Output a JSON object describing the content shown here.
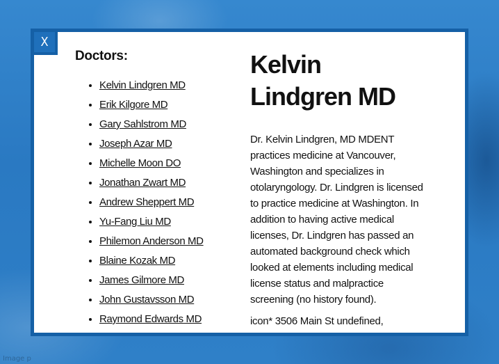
{
  "modal": {
    "close_label": "X"
  },
  "doctors": {
    "heading": "Doctors:",
    "items": [
      {
        "label": "Kelvin Lindgren MD"
      },
      {
        "label": "Erik Kilgore MD"
      },
      {
        "label": "Gary Sahlstrom MD"
      },
      {
        "label": "Joseph Azar MD"
      },
      {
        "label": "Michelle Moon DO"
      },
      {
        "label": "Jonathan Zwart MD"
      },
      {
        "label": "Andrew Sheppert MD"
      },
      {
        "label": "Yu-Fang Liu MD"
      },
      {
        "label": "Philemon Anderson MD"
      },
      {
        "label": "Blaine Kozak MD"
      },
      {
        "label": "James Gilmore MD"
      },
      {
        "label": "John Gustavsson MD"
      },
      {
        "label": "Raymond Edwards MD"
      }
    ]
  },
  "detail": {
    "name": "Kelvin Lindgren MD",
    "bio": "Dr. Kelvin Lindgren, MD MDENT practices medicine at Vancouver, Washington and specializes in otolaryngology. Dr. Lindgren is licensed to practice medicine at Washington. In addition to having active medical licenses, Dr. Lindgren has passed an automated background check which looked at elements including medical license status and malpractice screening (no history found).",
    "address": "icon* 3506 Main St undefined,"
  },
  "background": {
    "watermark": "Image p"
  },
  "colors": {
    "modal_border": "#1560a6",
    "close_button": "#1f70bb",
    "page_background": "#2a7bc4"
  }
}
